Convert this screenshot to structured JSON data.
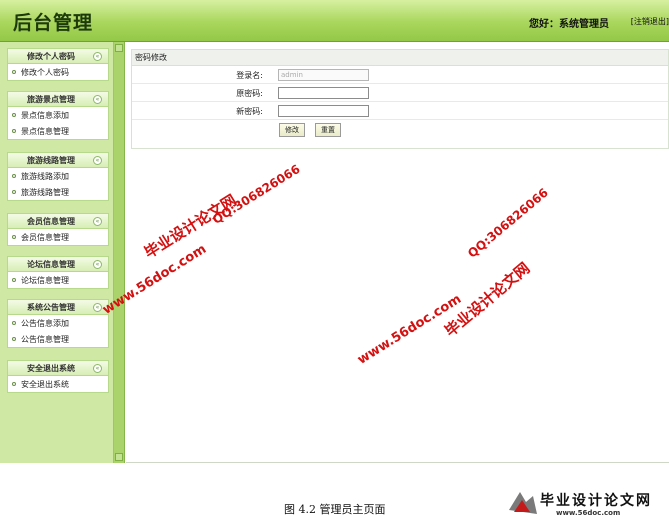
{
  "header": {
    "title": "后台管理",
    "greeting": "您好：系统管理员",
    "logout": "[注销退出]"
  },
  "sidebar": {
    "groups": [
      {
        "title": "修改个人密码",
        "items": [
          "修改个人密码"
        ]
      },
      {
        "title": "旅游景点管理",
        "items": [
          "景点信息添加",
          "景点信息管理"
        ]
      },
      {
        "title": "旅游线路管理",
        "items": [
          "旅游线路添加",
          "旅游线路管理"
        ]
      },
      {
        "title": "会员信息管理",
        "items": [
          "会员信息管理"
        ]
      },
      {
        "title": "论坛信息管理",
        "items": [
          "论坛信息管理"
        ]
      },
      {
        "title": "系统公告管理",
        "items": [
          "公告信息添加",
          "公告信息管理"
        ]
      },
      {
        "title": "安全退出系统",
        "items": [
          "安全退出系统"
        ]
      }
    ]
  },
  "form": {
    "title": "密码修改",
    "username_label": "登录名:",
    "username_value": "admin",
    "old_password_label": "原密码:",
    "new_password_label": "新密码:",
    "submit_label": "修改",
    "reset_label": "重置"
  },
  "watermarks": {
    "site_name": "毕业设计论文网",
    "qq": "QQ:306826066",
    "url": "www.56doc.com"
  },
  "caption": "图 4.2 管理员主页面",
  "logo": {
    "title": "毕业设计论文网",
    "url": "www.56doc.com"
  },
  "colors": {
    "header": "#a9d65c",
    "sidebar": "#cfe9a4",
    "watermark": "#d41010"
  }
}
